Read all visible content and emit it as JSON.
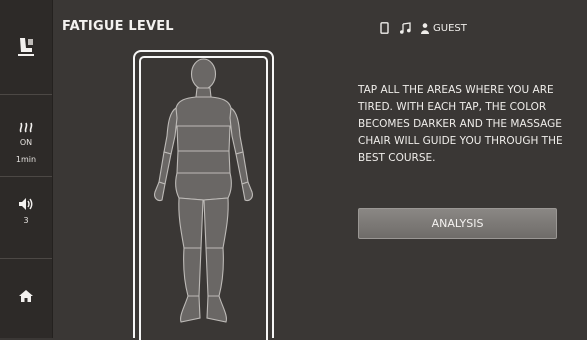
{
  "header": {
    "title": "FATIGUE LEVEL",
    "status_icons": [
      "phone-icon",
      "music-icon",
      "user-icon"
    ],
    "user_label": "GUEST"
  },
  "sidebar": {
    "heat": {
      "status": "ON",
      "duration": "1min",
      "icon": "heat-icon"
    },
    "volume": {
      "level": "3",
      "icon": "speaker-icon"
    },
    "chair_icon": "massage-chair-icon",
    "home_icon": "home-icon"
  },
  "main": {
    "instructions": "TAP ALL THE AREAS WHERE YOU ARE TIRED. WITH EACH TAP, THE COLOR BECOMES DARKER AND THE MASSAGE CHAIR WILL GUIDE YOU THROUGH THE BEST COURSE.",
    "analysis_label": "ANALYSIS"
  }
}
